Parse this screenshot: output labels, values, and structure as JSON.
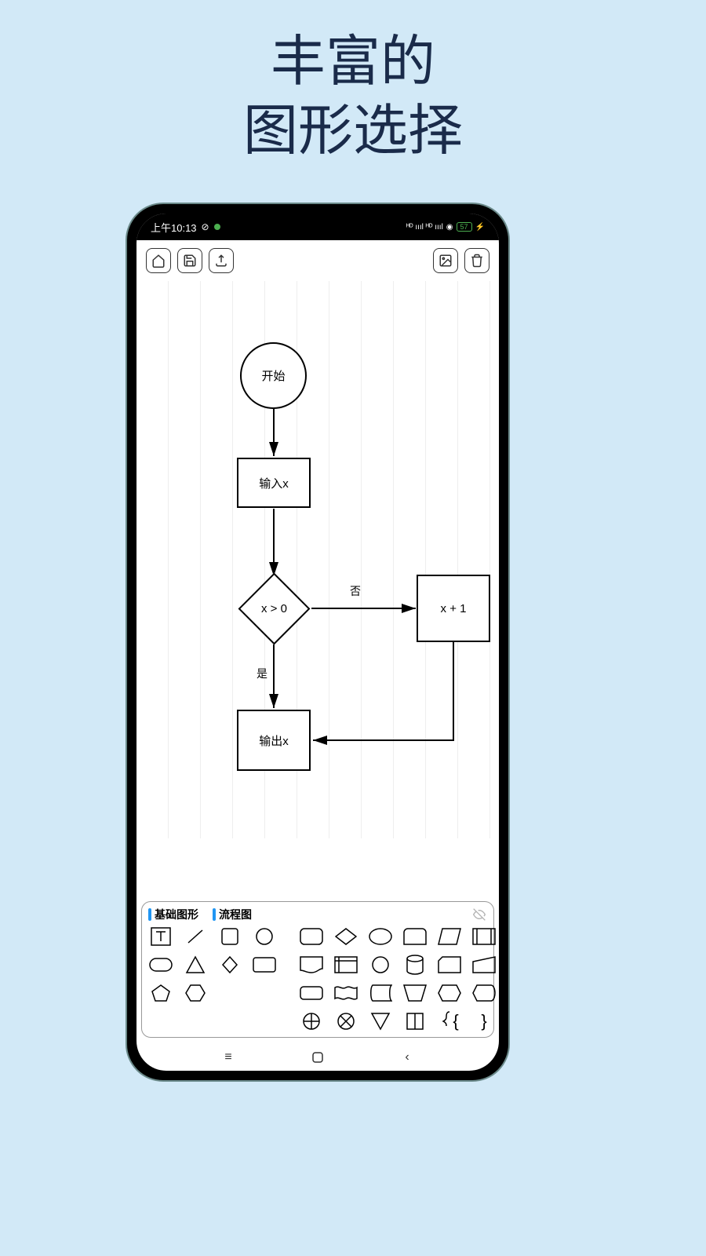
{
  "heading": {
    "line1": "丰富的",
    "line2": "图形选择"
  },
  "status": {
    "time": "上午10:13",
    "battery": "57"
  },
  "flowchart": {
    "start": "开始",
    "input": "输入x",
    "decision": "x > 0",
    "no_label": "否",
    "yes_label": "是",
    "process": "x + 1",
    "output": "输出x"
  },
  "panel": {
    "tab1": "基础图形",
    "tab2": "流程图"
  }
}
